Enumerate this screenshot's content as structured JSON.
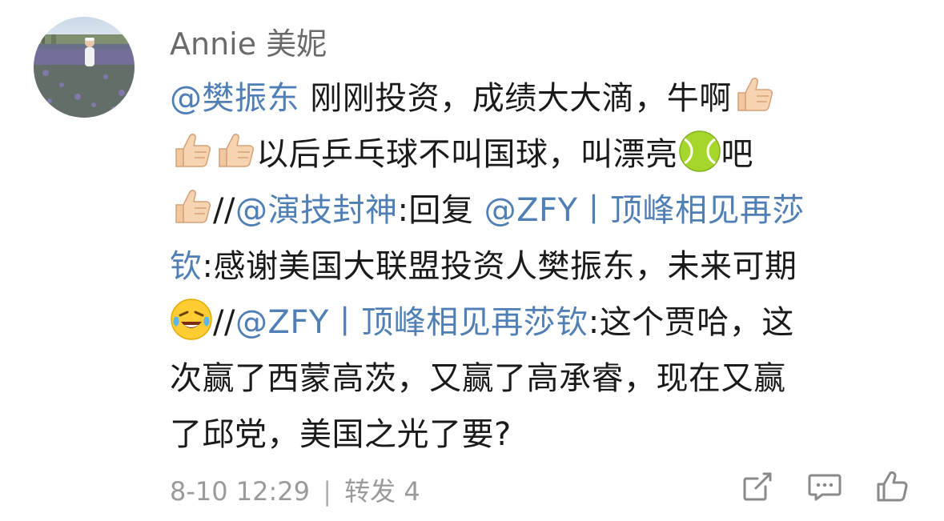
{
  "post": {
    "username": "Annie 美妮",
    "lines": [
      [
        {
          "t": "mention",
          "text": "@樊振东"
        },
        {
          "t": "text",
          "text": " 刚刚投资，成绩大大滴，牛啊"
        },
        {
          "t": "emoji",
          "icon": "thumbs-up-icon"
        }
      ],
      [
        {
          "t": "emoji",
          "icon": "thumbs-up-icon"
        },
        {
          "t": "emoji",
          "icon": "thumbs-up-icon"
        },
        {
          "t": "text",
          "text": "以后乒乓球不叫国球，叫漂亮"
        },
        {
          "t": "emoji",
          "icon": "tennis-ball-icon"
        },
        {
          "t": "text",
          "text": "吧"
        }
      ],
      [
        {
          "t": "emoji",
          "icon": "thumbs-up-icon"
        },
        {
          "t": "text",
          "text": "//"
        },
        {
          "t": "mention",
          "text": "@演技封神"
        },
        {
          "t": "text",
          "text": ":回复 "
        },
        {
          "t": "mention",
          "text": "@ZFY丨顶峰相见再莎"
        }
      ],
      [
        {
          "t": "mention",
          "text": "钦"
        },
        {
          "t": "text",
          "text": ":感谢美国大联盟投资人樊振东，未来可期"
        }
      ],
      [
        {
          "t": "emoji",
          "icon": "laughing-crying-icon"
        },
        {
          "t": "text",
          "text": "//"
        },
        {
          "t": "mention",
          "text": "@ZFY丨顶峰相见再莎钦"
        },
        {
          "t": "text",
          "text": ":这个贾哈，这"
        }
      ],
      [
        {
          "t": "text",
          "text": "次赢了西蒙高茨，又赢了高承睿，现在又赢"
        }
      ],
      [
        {
          "t": "text",
          "text": "了邱党，美国之光了要?"
        }
      ]
    ],
    "timestamp": "8-10 12:29",
    "separator": "|",
    "repost_label": "转发 4",
    "actions": {
      "repost_icon": "share-icon",
      "comment_icon": "comment-icon",
      "like_icon": "like-icon"
    }
  }
}
